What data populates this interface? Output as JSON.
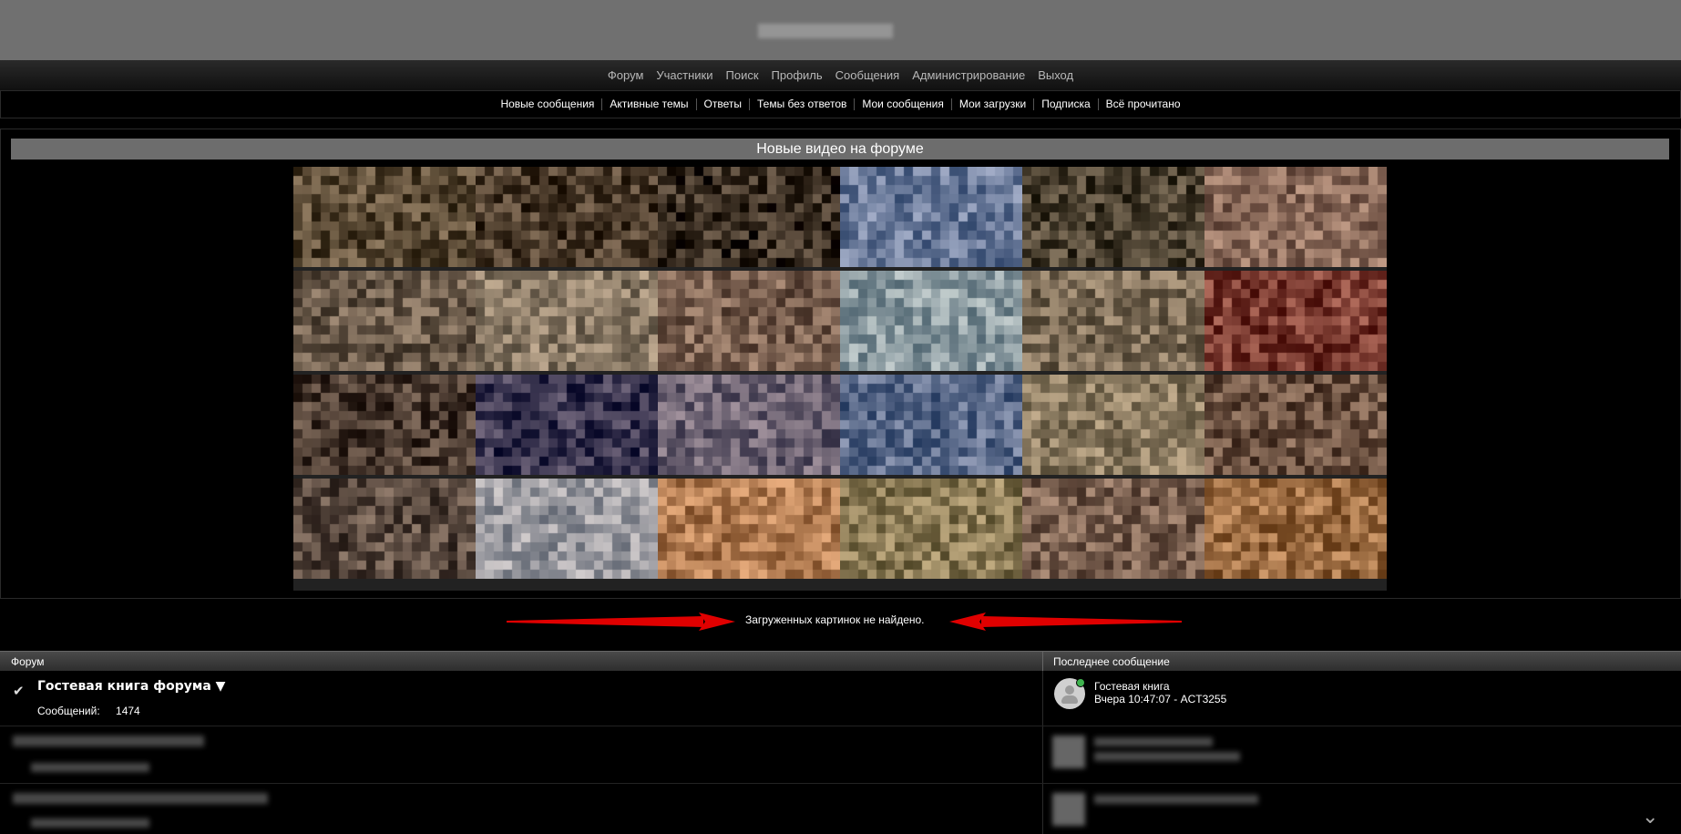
{
  "main_nav": [
    "Форум",
    "Участники",
    "Поиск",
    "Профиль",
    "Сообщения",
    "Администрирование",
    "Выход"
  ],
  "sub_nav": [
    "Новые сообщения",
    "Активные темы",
    "Ответы",
    "Темы без ответов",
    "Мои сообщения",
    "Мои загрузки",
    "Подписка",
    "Всё прочитано"
  ],
  "videos": {
    "title": "Новые видео на форуме",
    "thumb_colors": [
      [
        "#5a4a35",
        "#4a3a2a",
        "#3a2e22",
        "#6a7a9a",
        "#4a4030",
        "#8a6a5a"
      ],
      [
        "#6a5a4a",
        "#8a7a66",
        "#7a6050",
        "#8a9aa0",
        "#7a6a55",
        "#7a3a30"
      ],
      [
        "#4a3a30",
        "#3a3550",
        "#6a6070",
        "#5a6a8a",
        "#8a7a60",
        "#6a5040"
      ],
      [
        "#5a4a40",
        "#9a9aa0",
        "#b07a50",
        "#8a7a55",
        "#7a6050",
        "#9a6a40"
      ]
    ]
  },
  "notice": "Загруженных картинок не найдено.",
  "accent_red": "#e00000",
  "table": {
    "col_forum": "Форум",
    "col_last": "Последнее сообщение",
    "row1": {
      "title": "Гостевая книга форума ▼",
      "posts_label": "Сообщений:",
      "posts_count": "1474",
      "last_topic": "Гостевая книга",
      "last_meta": "Вчера 10:47:07 - ACT3255"
    }
  }
}
